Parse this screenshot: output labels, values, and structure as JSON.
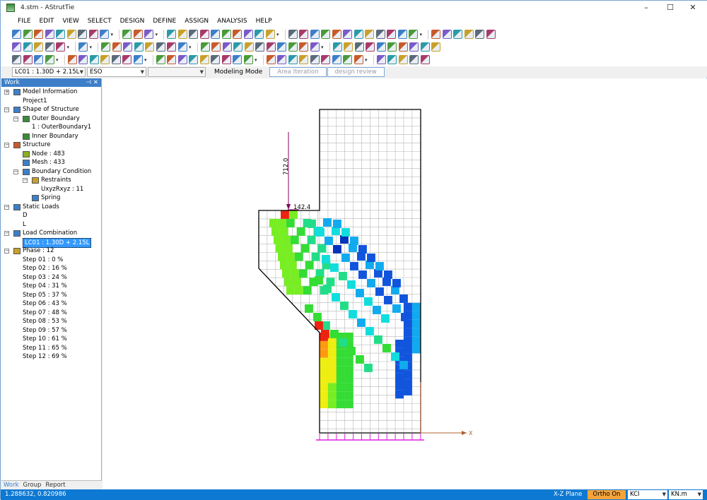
{
  "window": {
    "title": "4.stm - AStrutTie",
    "min": "–",
    "max": "☐",
    "close": "✕"
  },
  "menu": [
    "FILE",
    "EDIT",
    "VIEW",
    "SELECT",
    "DESIGN",
    "DEFINE",
    "ASSIGN",
    "ANALYSIS",
    "HELP"
  ],
  "toolbar": {
    "combo_loadcase": "LC01 : 1.30D + 2.15L",
    "combo_method": "ESO",
    "combo_empty": "",
    "mode_label": "Modeling Mode",
    "tab_area": "Area Iteration",
    "tab_design": "design review"
  },
  "panel": {
    "title": "Work",
    "tabs": [
      "Work",
      "Group",
      "Report"
    ],
    "tree": {
      "model_info": "Model Information",
      "project": "Project1",
      "shape": "Shape of Structure",
      "outer_boundary": "Outer Boundary",
      "outer_boundary1": "1 : OuterBoundary1",
      "inner_boundary": "Inner Boundary",
      "structure": "Structure",
      "node": "Node : 483",
      "mesh": "Mesh : 433",
      "boundary": "Boundary Condition",
      "restraints": "Restraints",
      "uxyz": "UxyzRxyz : 11",
      "spring": "Spring",
      "static_loads": "Static Loads",
      "load_d": "D",
      "load_l": "L",
      "load_combination": "Load Combination",
      "lc01": "LC01 : 1.30D + 2.15L",
      "phase": "Phase : 12",
      "steps": [
        "Step 01 :  0 %",
        "Step 02 : 16 %",
        "Step 03 : 24 %",
        "Step 04 : 31 %",
        "Step 05 : 37 %",
        "Step 06 : 43 %",
        "Step 07 : 48 %",
        "Step 08 : 53 %",
        "Step 09 : 57 %",
        "Step 10 : 61 %",
        "Step 11 : 65 %",
        "Step 12 : 69 %"
      ]
    }
  },
  "model": {
    "load_vertical": "712.0",
    "load_horizontal": "142.4",
    "axis_label": "X"
  },
  "status": {
    "coords": "1.288632, 0.820986",
    "plane": "X-Z Plane",
    "ortho": "Ortho On",
    "code": "KCI",
    "unit": "KN.m"
  },
  "colors": {
    "accent": "#0d79d3",
    "ortho": "#f3a33b",
    "load": "#800060",
    "support": "#e020e0"
  }
}
